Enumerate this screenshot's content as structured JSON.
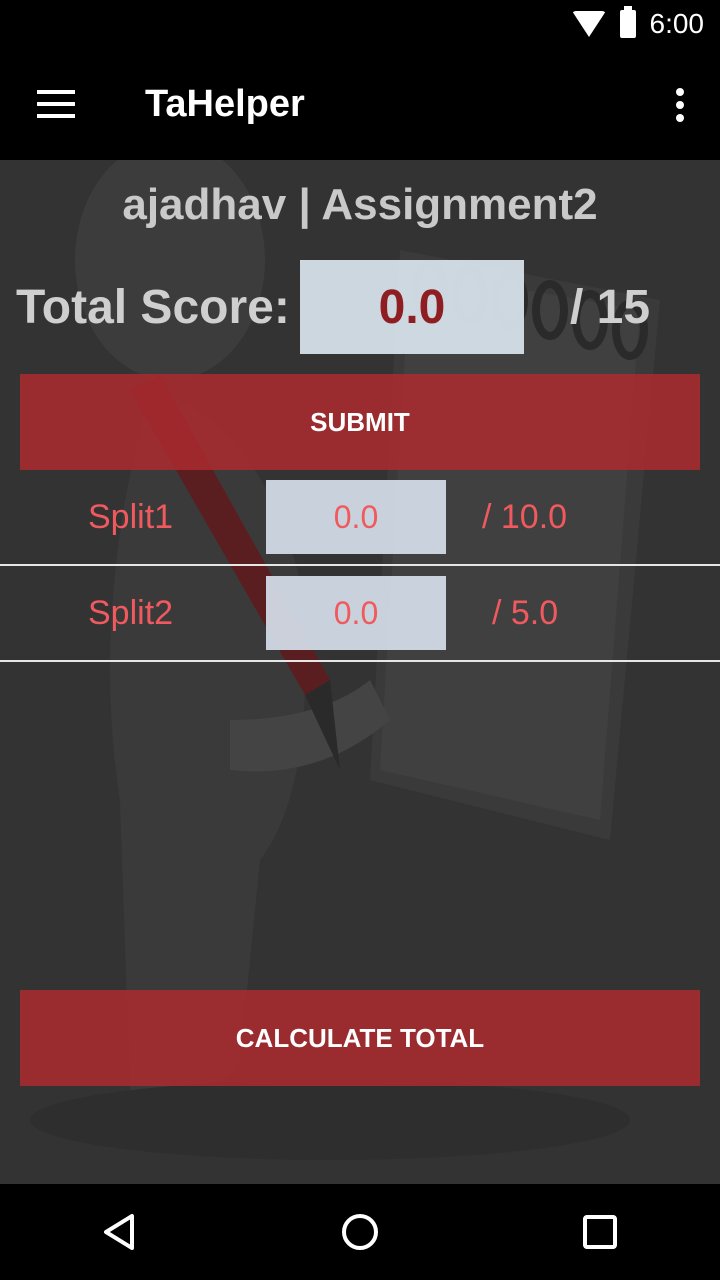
{
  "status_bar": {
    "time": "6:00",
    "icons": [
      "wifi-icon",
      "battery-icon"
    ]
  },
  "app_bar": {
    "title": "TaHelper",
    "icons": [
      "menu-icon",
      "overflow-menu-icon"
    ]
  },
  "main": {
    "header": "ajadhav | Assignment2",
    "total_label": "Total Score:",
    "total_value": "0.0",
    "total_max": "/ 15",
    "submit_label": "SUBMIT",
    "splits": [
      {
        "name": "Split1",
        "value": "0.0",
        "max": "/ 10.0"
      },
      {
        "name": "Split2",
        "value": "0.0",
        "max": "/ 5.0"
      }
    ],
    "calculate_label": "CALCULATE TOTAL"
  },
  "nav_bar": {
    "icons": [
      "back-icon",
      "home-icon",
      "recents-icon"
    ]
  },
  "colors": {
    "accent": "#a82a2e",
    "split_text": "#f05a5e",
    "total_value": "#8e1e21",
    "background": "#333333"
  }
}
